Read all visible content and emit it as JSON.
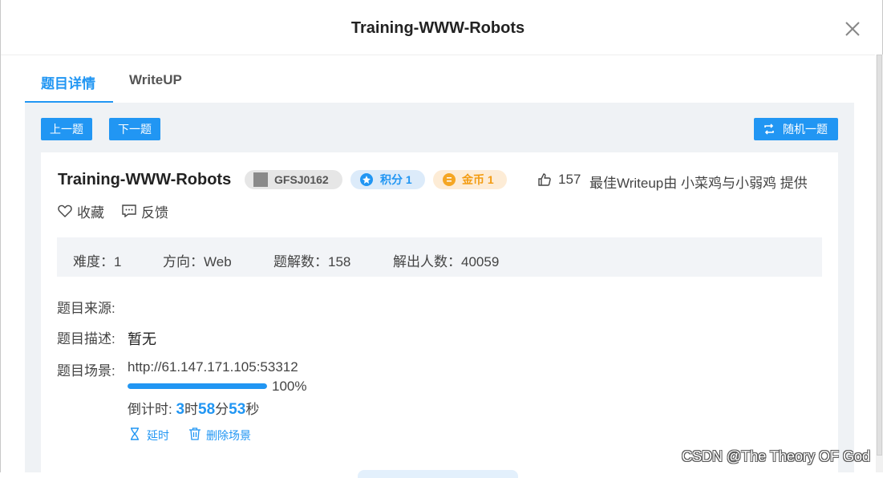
{
  "dialog": {
    "title": "Training-WWW-Robots"
  },
  "tabs": [
    {
      "label": "题目详情",
      "active": true
    },
    {
      "label": "WriteUP",
      "active": false
    }
  ],
  "toolbar": {
    "prev_label": "上一题",
    "next_label": "下一题",
    "random_label": "随机一题"
  },
  "challenge": {
    "title": "Training-WWW-Robots",
    "id_tag": "GFSJ0162",
    "score_tag": "积分 1",
    "gold_tag": "金币 1",
    "likes": "157",
    "writeup_credit": "最佳Writeup由 小菜鸡与小弱鸡 提供",
    "favorite_label": "收藏",
    "feedback_label": "反馈"
  },
  "stats": {
    "difficulty": "难度：1",
    "direction": "方向：Web",
    "solutions": "题解数：158",
    "solvers": "解出人数：40059"
  },
  "details": {
    "source_label": "题目来源:",
    "desc_label": "题目描述:",
    "desc_value": "暂无",
    "scene_label": "题目场景:",
    "scene_url": "http://61.147.171.105:53312",
    "progress_percent": 100,
    "progress_text": "100%",
    "countdown_prefix": "倒计时: ",
    "countdown_hours": "3",
    "unit_hour": "时",
    "countdown_minutes": "58",
    "unit_minute": "分",
    "countdown_seconds": "53",
    "unit_second": "秒",
    "extend_label": "延时",
    "delete_label": "删除场景"
  },
  "watermark": "CSDN @The Theory OF God",
  "colors": {
    "accent": "#2196f3",
    "gold": "#f39c12"
  }
}
